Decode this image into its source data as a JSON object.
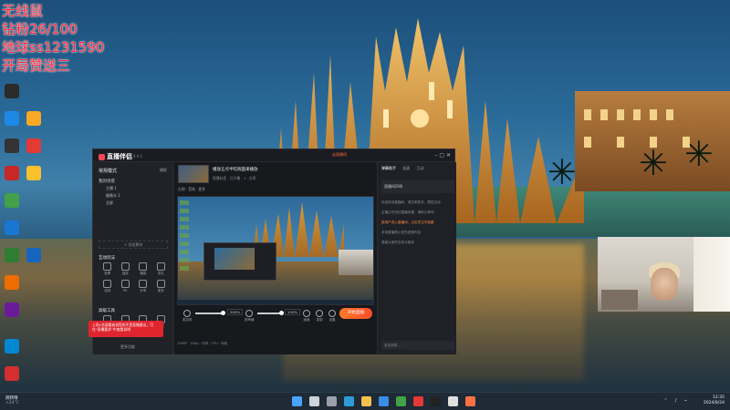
{
  "overlay": {
    "lines": [
      "无线鼠",
      "钻粉26/100",
      "地球ss1231590",
      "开局赞送三"
    ]
  },
  "desktop": {
    "icons": [
      {
        "name": "app-icon-1",
        "color": "#2b2b2b"
      },
      {
        "name": "app-icon-2",
        "color": "#1e88e5"
      },
      {
        "name": "app-icon-3",
        "color": "#333333"
      },
      {
        "name": "app-icon-4",
        "color": "#c62828"
      },
      {
        "name": "app-icon-5",
        "color": "#43a047"
      },
      {
        "name": "app-icon-6",
        "color": "#1976d2"
      },
      {
        "name": "app-icon-7",
        "color": "#2e7d32"
      },
      {
        "name": "app-icon-8",
        "color": "#ef6c00"
      },
      {
        "name": "app-icon-9",
        "color": "#6a1b9a"
      },
      {
        "name": "app-icon-10",
        "color": "#0288d1"
      },
      {
        "name": "app-icon-11",
        "color": "#d32f2f"
      },
      {
        "name": "app-icon-12",
        "color": "#f9a825"
      },
      {
        "name": "app-icon-13",
        "color": "#e53935"
      },
      {
        "name": "app-icon-14",
        "color": "#fbc02d"
      },
      {
        "name": "app-icon-15",
        "color": "#1565c0"
      }
    ]
  },
  "app": {
    "title": "直播伴侣",
    "version": "8.9.1",
    "mode_label": "常规模式",
    "mode_switch": "横屏",
    "scene_title": "我的场景",
    "scenes": [
      "主播 1",
      "摄像头 1",
      "全屏"
    ],
    "add_source": "+ 添加素材",
    "tools_title": "互动玩法",
    "tools": [
      "投票",
      "抽奖",
      "福袋",
      "送礼",
      "连线",
      "PK",
      "分享",
      "更多"
    ],
    "advanced_title": "高级工具",
    "advanced": [
      "美颜",
      "滤镜",
      "贴纸",
      "特效"
    ],
    "more_functions": "更多功能",
    "toast": "上场1名观看者说您的不是直播建议，可在“直播要求”中查看说明",
    "stream_title": "播放五点半吃碗面来播放",
    "stream_sub": "直播标签 · 已开播 · 1 · 分享",
    "live_bar": "左侧 · 音效 · 更多",
    "top_action": "去直播间",
    "volume_1": "200%",
    "volume_2": "100%",
    "controls": [
      "麦克风",
      "扬声器",
      "画面",
      "录制",
      "设置"
    ],
    "go_live": "开始直播",
    "status": "1080P · 30fps · 码率 · CPU · 网络",
    "right_tabs": [
      "弹幕助手",
      "连麦",
      "互动"
    ],
    "right_section": "直播间声明",
    "messages": [
      "欢迎来到直播间，请文明发言，理性互动",
      "主播正在测试直播效果，请耐心等待",
      "新用户进入直播间，点击关注不迷路",
      "本场直播禁止发布违规内容",
      "感谢大家的支持与陪伴"
    ],
    "input_placeholder": "发送消息..."
  },
  "taskbar": {
    "weather_temp": "阴转晴",
    "weather_sub": "+24°C",
    "time": "12:35",
    "date": "2024/8/24",
    "icons": [
      {
        "name": "start-icon",
        "color": "#4aa3ff"
      },
      {
        "name": "search-icon",
        "color": "#cfd2d8"
      },
      {
        "name": "taskview-icon",
        "color": "#9aa0aa"
      },
      {
        "name": "edge-icon",
        "color": "#2e9bd6"
      },
      {
        "name": "explorer-icon",
        "color": "#f2c14e"
      },
      {
        "name": "store-icon",
        "color": "#3c8ce7"
      },
      {
        "name": "app-icon",
        "color": "#43a047"
      },
      {
        "name": "app-icon",
        "color": "#e53935"
      },
      {
        "name": "app-icon",
        "color": "#222222"
      },
      {
        "name": "app-icon",
        "color": "#e0e0e0"
      },
      {
        "name": "app-icon",
        "color": "#ff7043"
      }
    ]
  }
}
